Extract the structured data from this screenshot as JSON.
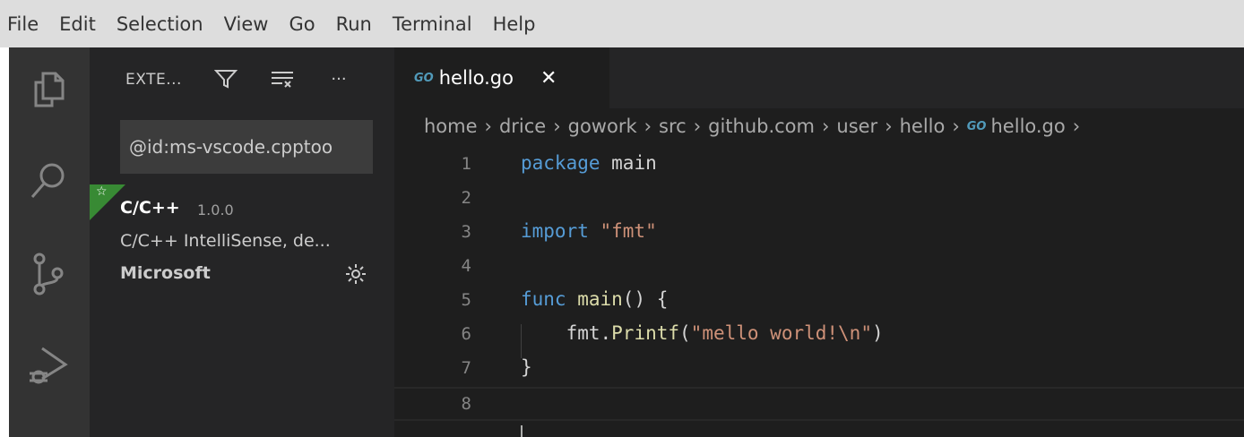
{
  "menu": [
    "File",
    "Edit",
    "Selection",
    "View",
    "Go",
    "Run",
    "Terminal",
    "Help"
  ],
  "activity_bar": {
    "icons": [
      "explorer-icon",
      "search-icon",
      "source-control-icon",
      "run-debug-icon"
    ]
  },
  "sidebar": {
    "title": "EXTE...",
    "actions": [
      "filter-icon",
      "clear-extensions-icon",
      "more-actions-icon"
    ],
    "more_label": "···",
    "search_value": "@id:ms-vscode.cpptoo",
    "extension": {
      "badge": "☆",
      "name": "C/C++",
      "version": "1.0.0",
      "description": "C/C++ IntelliSense, de...",
      "publisher": "Microsoft"
    }
  },
  "editor": {
    "tab": {
      "label": "hello.go",
      "close": "✕",
      "icon_text": "GO"
    },
    "breadcrumb": [
      "home",
      "drice",
      "gowork",
      "src",
      "github.com",
      "user",
      "hello",
      "hello.go"
    ],
    "breadcrumb_sep": "›",
    "line_numbers": [
      "1",
      "2",
      "3",
      "4",
      "5",
      "6",
      "7",
      "8"
    ],
    "code": {
      "l1_kw": "package",
      "l1_rest": " main",
      "l3_kw": "import",
      "l3_str": " \"fmt\"",
      "l5_kw": "func",
      "l5_fn": " main",
      "l5_rest": "() {",
      "l6_pre": "    fmt.",
      "l6_fn": "Printf",
      "l6_open": "(",
      "l6_str": "\"mello world!\\n\"",
      "l6_close": ")",
      "l7": "}"
    }
  },
  "colors": {
    "menubar": "#dddddd",
    "activity_bar": "#333333",
    "sidebar": "#252526",
    "editor": "#1e1e1e",
    "keyword": "#569cd6",
    "string": "#ce9178",
    "function": "#dcdcaa",
    "go_icon": "#519aba",
    "badge": "#388a34"
  }
}
